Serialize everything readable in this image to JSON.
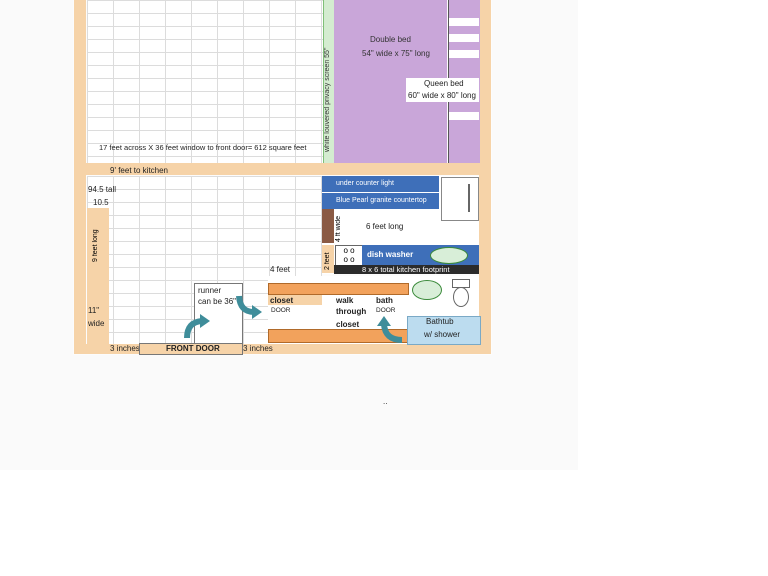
{
  "labels": {
    "screen": "white louvered privacy screen  55\"",
    "double_bed": "Double bed",
    "double_bed_size": "54\"  wide x 75\" long",
    "queen_bed": "Queen bed",
    "queen_bed_size": "60\" wide x 80\" long",
    "area": "17 feet across X 36 feet window to front door= 612 square feet",
    "to_kitchen": "9' feet to kitchen",
    "tall": "94.5 tall",
    "ten_five": "10.5",
    "nine_feet": "9 feet long",
    "eleven": "11\"",
    "wide": "wide",
    "under_counter": "under counter light",
    "countertop": "Blue Pearl granite countertop",
    "six_feet": "6 feet long",
    "four_ft": "4 ft wide",
    "two_feet": "2 feet",
    "dish_washer": "dish washer",
    "kitchen_footprint": "8 x 6 total kitchen footprint",
    "four_feet": "4 feet",
    "runner": "runner",
    "runner2": "can be 36\"",
    "closet": "closet",
    "door": "DOOR",
    "walk": "walk",
    "through": "through",
    "closet2": "closet",
    "bath": "bath",
    "bath_door": "DOOR",
    "bathtub": "Bathtub",
    "shower": "w/ shower",
    "three_inches_left": "3 inches",
    "front_door": "FRONT DOOR",
    "three_inches_right": "3 inches",
    "dots": ".."
  }
}
